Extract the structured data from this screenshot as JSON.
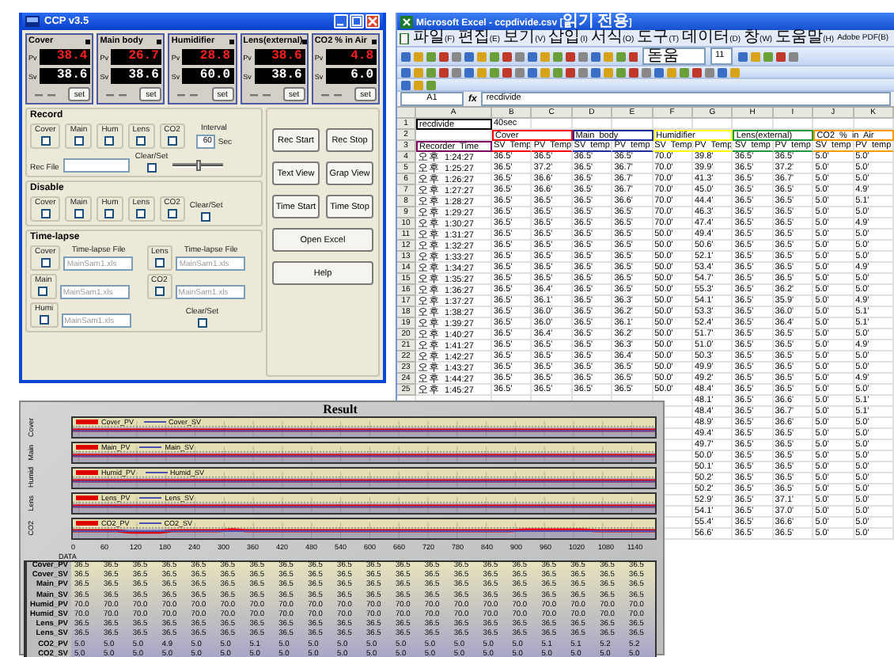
{
  "ccp": {
    "title": "CCP v3.5",
    "controllers": [
      {
        "name": "Cover",
        "pv_label": "Pv",
        "pv": "38.4",
        "sv_label": "Sv",
        "sv": "38.6",
        "button": "set"
      },
      {
        "name": "Main body",
        "pv_label": "Pv",
        "pv": "26.7",
        "sv_label": "Sv",
        "sv": "38.6",
        "button": "set"
      },
      {
        "name": "Humidifier",
        "pv_label": "Pv",
        "pv": "28.8",
        "sv_label": "Sv",
        "sv": "60.0",
        "button": "set"
      },
      {
        "name": "Lens(external)",
        "pv_label": "Pv",
        "pv": "38.6",
        "sv_label": "Sv",
        "sv": "38.6",
        "button": "set"
      },
      {
        "name": "CO2 % in Air",
        "pv_label": "Pv",
        "pv": "4.8",
        "sv_label": "Sv",
        "sv": "6.0",
        "button": "set"
      }
    ],
    "record": {
      "title": "Record",
      "channels": [
        {
          "label": "Cover",
          "checked": false
        },
        {
          "label": "Main",
          "checked": false
        },
        {
          "label": "Hum",
          "checked": false
        },
        {
          "label": "Lens",
          "checked": false
        },
        {
          "label": "CO2",
          "checked": false
        }
      ],
      "interval_label": "Interval",
      "interval": "60",
      "interval_unit": "Sec",
      "file_label": "Rec File",
      "clear_label": "Clear/Set",
      "clear_checked": false,
      "slider": {
        "level": 0.5
      }
    },
    "disable": {
      "title": "Disable",
      "channels": [
        {
          "label": "Cover",
          "checked": false
        },
        {
          "label": "Main",
          "checked": false
        },
        {
          "label": "Hum",
          "checked": false
        },
        {
          "label": "Lens",
          "checked": false
        },
        {
          "label": "CO2",
          "checked": false
        }
      ],
      "clear_label": "Clear/Set",
      "clear_checked": false
    },
    "timelapse": {
      "title": "Time-lapse",
      "items": [
        {
          "label": "Cover",
          "checked": false,
          "file_label": "Time-lapse File",
          "placeholder": "MainSam1.xls"
        },
        {
          "label": "Lens",
          "checked": false,
          "file_label": "Time-lapse File",
          "placeholder": "MainSam1.xls"
        },
        {
          "label": "Main",
          "checked": false,
          "placeholder": "MainSam1.xls"
        },
        {
          "label": "CO2",
          "checked": false,
          "placeholder": "MainSam1.xls"
        },
        {
          "label": "Humi",
          "checked": false,
          "placeholder": "MainSam1.xls"
        }
      ],
      "clear_label": "Clear/Set",
      "clear_checked": false
    },
    "buttons": [
      "Rec Start",
      "Rec Stop",
      "Text View",
      "Grap View",
      "Time Start",
      "Time Stop",
      "Open Excel",
      "Help"
    ]
  },
  "excel": {
    "title": "Microsoft Excel - ccpdivide.csv [읽기 전용]",
    "menu": [
      "파일(F)",
      "편집(E)",
      "보기(V)",
      "삽입(I)",
      "서식(O)",
      "도구(T)",
      "데이터(D)",
      "창(W)",
      "도움말(H)",
      "Adobe PDF(B)"
    ],
    "font_name": "돋움",
    "font_size": "11",
    "name_box": "A1",
    "fx_label": "fx",
    "formula": "recdivide",
    "columns": [
      "A",
      "B",
      "C",
      "D",
      "E",
      "F",
      "G",
      "H",
      "I",
      "J",
      "K"
    ],
    "row1": {
      "num": "1",
      "cells": [
        {
          "text": "recdivide",
          "selected": true
        },
        {
          "text": "40sec",
          "selected": false
        }
      ]
    },
    "group_row": {
      "num": "2",
      "groups": [
        {
          "label": "Cover",
          "color": "#ff0000"
        },
        {
          "label": "Main body",
          "color": "#1c2fa0"
        },
        {
          "label": "Humidifier",
          "color": "#ffff00"
        },
        {
          "label": "Lens(external)",
          "color": "#1f9a3c"
        },
        {
          "label": "CO2 % in Air",
          "color": "#ff9900"
        }
      ]
    },
    "header_row": {
      "num": "3",
      "time": {
        "label": "Recorder Time",
        "color": "#800060"
      },
      "labels": [
        "SV Temp",
        "PV Temp",
        "SV temp",
        "PV temp",
        "SV Temp",
        "PV Temp",
        "SV temp",
        "PV temp",
        "SV temp",
        "PV temp"
      ]
    },
    "data_rows": [
      {
        "num": "4",
        "cells": [
          "오후 1:24:27",
          "36.5'",
          "36.5'",
          "36.5'",
          "36.5'",
          "70.0'",
          "39.8'",
          "36.5'",
          "36.5'",
          "5.0'",
          "5.0'"
        ]
      },
      {
        "num": "5",
        "cells": [
          "오후 1:25:27",
          "36.5'",
          "37.2'",
          "36.5'",
          "36.7'",
          "70.0'",
          "39.9'",
          "36.5'",
          "37.2'",
          "5.0'",
          "5.0'"
        ]
      },
      {
        "num": "6",
        "cells": [
          "오후 1:26:27",
          "36.5'",
          "36.6'",
          "36.5'",
          "36.7'",
          "70.0'",
          "41.3'",
          "36.5'",
          "36.7'",
          "5.0'",
          "5.0'"
        ]
      },
      {
        "num": "7",
        "cells": [
          "오후 1:27:27",
          "36.5'",
          "36.6'",
          "36.5'",
          "36.7'",
          "70.0'",
          "45.0'",
          "36.5'",
          "36.5'",
          "5.0'",
          "4.9'"
        ]
      },
      {
        "num": "8",
        "cells": [
          "오후 1:28:27",
          "36.5'",
          "36.5'",
          "36.5'",
          "36.6'",
          "70.0'",
          "44.4'",
          "36.5'",
          "36.5'",
          "5.0'",
          "5.1'"
        ]
      },
      {
        "num": "9",
        "cells": [
          "오후 1:29:27",
          "36.5'",
          "36.5'",
          "36.5'",
          "36.5'",
          "70.0'",
          "46.3'",
          "36.5'",
          "36.5'",
          "5.0'",
          "5.0'"
        ]
      },
      {
        "num": "10",
        "cells": [
          "오후 1:30:27",
          "36.5'",
          "36.5'",
          "36.5'",
          "36.5'",
          "70.0'",
          "47.4'",
          "36.5'",
          "36.5'",
          "5.0'",
          "4.9'"
        ]
      },
      {
        "num": "11",
        "cells": [
          "오후 1:31:27",
          "36.5'",
          "36.5'",
          "36.5'",
          "36.5'",
          "50.0'",
          "49.4'",
          "36.5'",
          "36.5'",
          "5.0'",
          "5.0'"
        ]
      },
      {
        "num": "12",
        "cells": [
          "오후 1:32:27",
          "36.5'",
          "36.5'",
          "36.5'",
          "36.5'",
          "50.0'",
          "50.6'",
          "36.5'",
          "36.5'",
          "5.0'",
          "5.0'"
        ]
      },
      {
        "num": "13",
        "cells": [
          "오후 1:33:27",
          "36.5'",
          "36.5'",
          "36.5'",
          "36.5'",
          "50.0'",
          "52.1'",
          "36.5'",
          "36.5'",
          "5.0'",
          "5.0'"
        ]
      },
      {
        "num": "14",
        "cells": [
          "오후 1:34:27",
          "36.5'",
          "36.5'",
          "36.5'",
          "36.5'",
          "50.0'",
          "53.4'",
          "36.5'",
          "36.5'",
          "5.0'",
          "4.9'"
        ]
      },
      {
        "num": "15",
        "cells": [
          "오후 1:35:27",
          "36.5'",
          "36.5'",
          "36.5'",
          "36.5'",
          "50.0'",
          "54.7'",
          "36.5'",
          "36.5'",
          "5.0'",
          "5.0'"
        ]
      },
      {
        "num": "16",
        "cells": [
          "오후 1:36:27",
          "36.5'",
          "36.4'",
          "36.5'",
          "36.5'",
          "50.0'",
          "55.3'",
          "36.5'",
          "36.2'",
          "5.0'",
          "5.0'"
        ]
      },
      {
        "num": "17",
        "cells": [
          "오후 1:37:27",
          "36.5'",
          "36.1'",
          "36.5'",
          "36.3'",
          "50.0'",
          "54.1'",
          "36.5'",
          "35.9'",
          "5.0'",
          "4.9'"
        ]
      },
      {
        "num": "18",
        "cells": [
          "오후 1:38:27",
          "36.5'",
          "36.0'",
          "36.5'",
          "36.2'",
          "50.0'",
          "53.3'",
          "36.5'",
          "36.0'",
          "5.0'",
          "5.1'"
        ]
      },
      {
        "num": "19",
        "cells": [
          "오후 1:39:27",
          "36.5'",
          "36.0'",
          "36.5'",
          "36.1'",
          "50.0'",
          "52.4'",
          "36.5'",
          "36.4'",
          "5.0'",
          "5.1'"
        ]
      },
      {
        "num": "20",
        "cells": [
          "오후 1:40:27",
          "36.5'",
          "36.4'",
          "36.5'",
          "36.2'",
          "50.0'",
          "51.7'",
          "36.5'",
          "36.5'",
          "5.0'",
          "5.0'"
        ]
      },
      {
        "num": "21",
        "cells": [
          "오후 1:41:27",
          "36.5'",
          "36.5'",
          "36.5'",
          "36.3'",
          "50.0'",
          "51.0'",
          "36.5'",
          "36.5'",
          "5.0'",
          "4.9'"
        ]
      },
      {
        "num": "22",
        "cells": [
          "오후 1:42:27",
          "36.5'",
          "36.5'",
          "36.5'",
          "36.4'",
          "50.0'",
          "50.3'",
          "36.5'",
          "36.5'",
          "5.0'",
          "5.0'"
        ]
      },
      {
        "num": "23",
        "cells": [
          "오후 1:43:27",
          "36.5'",
          "36.5'",
          "36.5'",
          "36.5'",
          "50.0'",
          "49.9'",
          "36.5'",
          "36.5'",
          "5.0'",
          "5.0'"
        ]
      },
      {
        "num": "24",
        "cells": [
          "오후 1:44:27",
          "36.5'",
          "36.5'",
          "36.5'",
          "36.5'",
          "50.0'",
          "49.2'",
          "36.5'",
          "36.5'",
          "5.0'",
          "4.9'"
        ]
      },
      {
        "num": "25",
        "cells": [
          "오후 1:45:27",
          "36.5'",
          "36.5'",
          "36.5'",
          "36.5'",
          "50.0'",
          "48.4'",
          "36.5'",
          "36.5'",
          "5.0'",
          "5.0'"
        ]
      }
    ],
    "partial_rows": [
      {
        "cells": [
          "48.1'",
          "36.5'",
          "36.6'",
          "5.0'",
          "5.1'"
        ]
      },
      {
        "cells": [
          "48.4'",
          "36.5'",
          "36.7'",
          "5.0'",
          "5.1'"
        ]
      },
      {
        "cells": [
          "48.9'",
          "36.5'",
          "36.6'",
          "5.0'",
          "5.0'"
        ]
      },
      {
        "cells": [
          "49.4'",
          "36.5'",
          "36.5'",
          "5.0'",
          "5.0'"
        ]
      },
      {
        "cells": [
          "49.7'",
          "36.5'",
          "36.5'",
          "5.0'",
          "5.0'"
        ]
      },
      {
        "cells": [
          "50.0'",
          "36.5'",
          "36.5'",
          "5.0'",
          "5.0'"
        ]
      },
      {
        "cells": [
          "50.1'",
          "36.5'",
          "36.5'",
          "5.0'",
          "5.0'"
        ]
      },
      {
        "cells": [
          "50.2'",
          "36.5'",
          "36.5'",
          "5.0'",
          "5.0'"
        ]
      },
      {
        "cells": [
          "50.2'",
          "36.5'",
          "36.5'",
          "5.0'",
          "5.0'"
        ]
      },
      {
        "cells": [
          "52.9'",
          "36.5'",
          "37.1'",
          "5.0'",
          "5.0'"
        ]
      },
      {
        "cells": [
          "54.1'",
          "36.5'",
          "37.0'",
          "5.0'",
          "5.0'"
        ]
      },
      {
        "cells": [
          "55.4'",
          "36.5'",
          "36.6'",
          "5.0'",
          "5.0'"
        ]
      },
      {
        "cells": [
          "56.6'",
          "36.5'",
          "36.5'",
          "5.0'",
          "5.0'"
        ]
      }
    ]
  },
  "result": {
    "title": "Result",
    "plots": [
      {
        "axis_label": "Cover",
        "kind": "flat",
        "series": [
          {
            "label": "Cover_PV",
            "color": "#e00000"
          },
          {
            "label": "Cover_SV",
            "color": "#5050b0"
          }
        ]
      },
      {
        "axis_label": "Main",
        "kind": "flat",
        "series": [
          {
            "label": "Main_PV",
            "color": "#e00000"
          },
          {
            "label": "Main_SV",
            "color": "#5050b0"
          }
        ]
      },
      {
        "axis_label": "Humid",
        "kind": "flat",
        "series": [
          {
            "label": "Humid_PV",
            "color": "#e00000"
          },
          {
            "label": "Humid_SV",
            "color": "#5050b0"
          }
        ]
      },
      {
        "axis_label": "Lens",
        "kind": "flat",
        "series": [
          {
            "label": "Lens_PV",
            "color": "#e00000"
          },
          {
            "label": "Lens_SV",
            "color": "#5050b0"
          }
        ]
      },
      {
        "axis_label": "CO2",
        "kind": "wavy",
        "series": [
          {
            "label": "CO2_PV",
            "color": "#e00000"
          },
          {
            "label": "CO2_SV",
            "color": "#5050b0"
          }
        ]
      }
    ],
    "x_ticks": [
      "0",
      "60",
      "120",
      "180",
      "240",
      "300",
      "360",
      "420",
      "480",
      "540",
      "600",
      "660",
      "720",
      "780",
      "840",
      "900",
      "960",
      "1020",
      "1080",
      "1140"
    ],
    "table_label": "DATA",
    "table": [
      {
        "label": "Cover_PV",
        "values": [
          "36.5",
          "36.5",
          "36.5",
          "36.5",
          "36.5",
          "36.5",
          "36.5",
          "36.5",
          "36.5",
          "36.5",
          "36.5",
          "36.5",
          "36.5",
          "36.5",
          "36.5",
          "36.5",
          "36.5",
          "36.5",
          "36.5",
          "36.5"
        ]
      },
      {
        "label": "Cover_SV",
        "values": [
          "36.5",
          "36.5",
          "36.5",
          "36.5",
          "36.5",
          "36.5",
          "36.5",
          "36.5",
          "36.5",
          "36.5",
          "36.5",
          "36.5",
          "36.5",
          "36.5",
          "36.5",
          "36.5",
          "36.5",
          "36.5",
          "36.5",
          "36.5"
        ]
      },
      {
        "label": "Main_PV",
        "values": [
          "36.5",
          "36.5",
          "36.5",
          "36.5",
          "36.5",
          "36.5",
          "36.5",
          "36.5",
          "36.5",
          "36.5",
          "36.5",
          "36.5",
          "36.5",
          "36.5",
          "36.5",
          "36.5",
          "36.5",
          "36.5",
          "36.5",
          "36.5"
        ]
      },
      {
        "label": "Main_SV",
        "values": [
          "36.5",
          "36.5",
          "36.5",
          "36.5",
          "36.5",
          "36.5",
          "36.5",
          "36.5",
          "36.5",
          "36.5",
          "36.5",
          "36.5",
          "36.5",
          "36.5",
          "36.5",
          "36.5",
          "36.5",
          "36.5",
          "36.5",
          "36.5"
        ]
      },
      {
        "label": "Humid_PV",
        "values": [
          "70.0",
          "70.0",
          "70.0",
          "70.0",
          "70.0",
          "70.0",
          "70.0",
          "70.0",
          "70.0",
          "70.0",
          "70.0",
          "70.0",
          "70.0",
          "70.0",
          "70.0",
          "70.0",
          "70.0",
          "70.0",
          "70.0",
          "70.0"
        ]
      },
      {
        "label": "Humid_SV",
        "values": [
          "70.0",
          "70.0",
          "70.0",
          "70.0",
          "70.0",
          "70.0",
          "70.0",
          "70.0",
          "70.0",
          "70.0",
          "70.0",
          "70.0",
          "70.0",
          "70.0",
          "70.0",
          "70.0",
          "70.0",
          "70.0",
          "70.0",
          "70.0"
        ]
      },
      {
        "label": "Lens_PV",
        "values": [
          "36.5",
          "36.5",
          "36.5",
          "36.5",
          "36.5",
          "36.5",
          "36.5",
          "36.5",
          "36.5",
          "36.5",
          "36.5",
          "36.5",
          "36.5",
          "36.5",
          "36.5",
          "36.5",
          "36.5",
          "36.5",
          "36.5",
          "36.5"
        ]
      },
      {
        "label": "Lens_SV",
        "values": [
          "36.5",
          "36.5",
          "36.5",
          "36.5",
          "36.5",
          "36.5",
          "36.5",
          "36.5",
          "36.5",
          "36.5",
          "36.5",
          "36.5",
          "36.5",
          "36.5",
          "36.5",
          "36.5",
          "36.5",
          "36.5",
          "36.5",
          "36.5"
        ]
      },
      {
        "label": "CO2_PV",
        "values": [
          "5.0",
          "5.0",
          "5.0",
          "4.9",
          "5.0",
          "5.0",
          "5.1",
          "5.0",
          "5.0",
          "5.0",
          "5.0",
          "5.0",
          "5.0",
          "5.0",
          "5.0",
          "5.0",
          "5.1",
          "5.1",
          "5.2",
          "5.2"
        ]
      },
      {
        "label": "CO2_SV",
        "values": [
          "5.0",
          "5.0",
          "5.0",
          "5.0",
          "5.0",
          "5.0",
          "5.0",
          "5.0",
          "5.0",
          "5.0",
          "5.0",
          "5.0",
          "5.0",
          "5.0",
          "5.0",
          "5.0",
          "5.0",
          "5.0",
          "5.0",
          "5.0"
        ]
      }
    ]
  }
}
